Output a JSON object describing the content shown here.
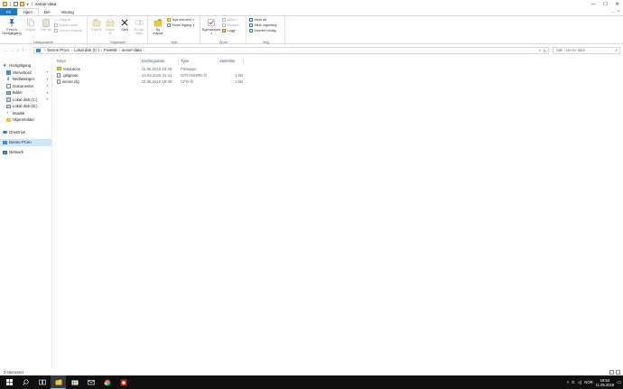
{
  "window": {
    "title": "server-data",
    "controls": {
      "minimize": "—",
      "maximize": "☐",
      "close": "✕"
    }
  },
  "ribbon": {
    "tabs": [
      {
        "label": "Fil"
      },
      {
        "label": "Hjem"
      },
      {
        "label": "Del"
      },
      {
        "label": "Visning"
      }
    ],
    "groups": {
      "clipboard": {
        "label": "Utklippstavle",
        "pin_label": "Fest til Hurtigtilgang",
        "copy_label": "Kopier",
        "paste_label": "Lim inn",
        "cut_label": "Klipp ut",
        "copy_path_label": "Kopier bane",
        "paste_shortcut_label": "Lim inn snarvei"
      },
      "organize": {
        "label": "Organiser",
        "move_label": "Flytt til",
        "copy_to_label": "Kopier til",
        "delete_label": "Slett",
        "rename_label": "Gi nytt navn"
      },
      "new": {
        "label": "Nytt",
        "new_folder_label": "Ny mappe",
        "new_item_label": "Nytt element",
        "easy_access_label": "Enkel tilgang"
      },
      "open": {
        "label": "Åpne",
        "properties_label": "Egenskaper",
        "open_label": "Åpne",
        "edit_label": "Rediger",
        "history_label": "Logg"
      },
      "select": {
        "label": "Velg",
        "select_all_label": "Merk alt",
        "select_none_label": "Merk ingenting",
        "invert_label": "Inverter utvalg"
      }
    }
  },
  "address": {
    "crumbs": [
      "Denne PCen",
      "Lokal disk (C:)",
      "FiveMS",
      "server-data"
    ],
    "search_placeholder": "Søk i server-data"
  },
  "sidebar": {
    "items": [
      {
        "label": "Hurtigtilgang"
      },
      {
        "label": "Skrivebord"
      },
      {
        "label": "Nedlastinger"
      },
      {
        "label": "Dokumenter"
      },
      {
        "label": "Bilder"
      },
      {
        "label": "Lokal disk (C:)"
      },
      {
        "label": "Lokal disk (D:)"
      },
      {
        "label": "Musikk"
      },
      {
        "label": "Skjermbilder"
      },
      {
        "label": "OneDrive"
      },
      {
        "label": "Denne PCen"
      },
      {
        "label": "Nettverk"
      }
    ]
  },
  "filelist": {
    "columns": {
      "name": "Navn",
      "date": "Endringsdato",
      "type": "Type",
      "size": "Størrelse"
    },
    "rows": [
      {
        "name": "resources",
        "date": "11.05.2018 18:36",
        "type": "Filmappe",
        "size": ""
      },
      {
        "name": ".gitignore",
        "date": "24.04.2018 21:41",
        "type": "GITIGNORE-fil",
        "size": "1 kB"
      },
      {
        "name": "server.cfg",
        "date": "11.05.2018 19:48",
        "type": "CFG-fil",
        "size": "2 kB"
      }
    ]
  },
  "status": {
    "count_text": "3 elementer"
  },
  "taskbar": {
    "time": "19:52",
    "date": "11.05.2018",
    "lang": "NOR"
  },
  "colors": {
    "accent": "#1979ca",
    "selection": "#cce8ff",
    "folder": "#f0c541"
  }
}
